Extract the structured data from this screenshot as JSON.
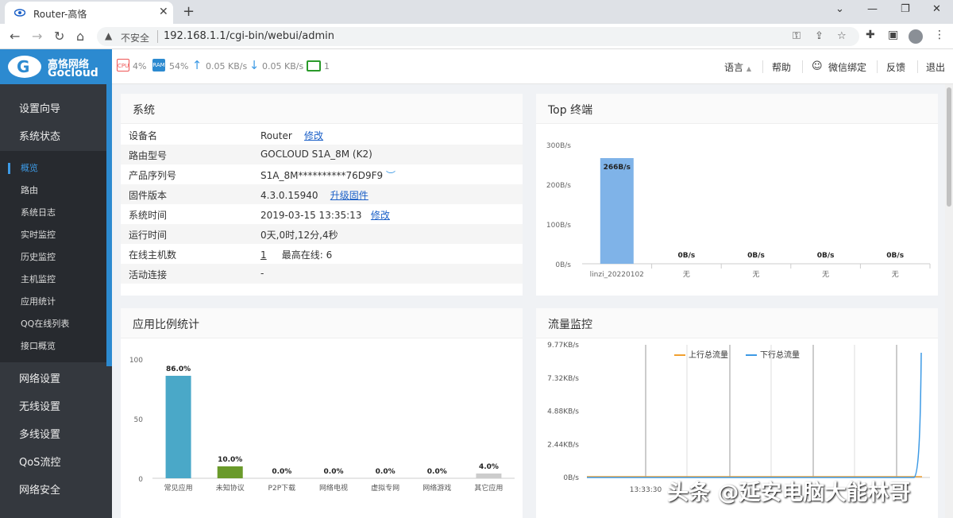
{
  "browser": {
    "tab_title": "Router-高恪",
    "insecure_label": "不安全",
    "url": "192.168.1.1/cgi-bin/webui/admin"
  },
  "logo": {
    "cn": "高恪网络",
    "en": "Gocloud"
  },
  "status_bar": {
    "cpu": "4%",
    "ram": "54%",
    "upload": "0.05 KB/s",
    "download": "0.05 KB/s",
    "online": "1"
  },
  "header_links": {
    "language": "语言",
    "help": "帮助",
    "wechat": "微信绑定",
    "feedback": "反馈",
    "logout": "退出"
  },
  "sidebar": {
    "groups_top": [
      "设置向导",
      "系统状态"
    ],
    "items": [
      "概览",
      "路由",
      "系统日志",
      "实时监控",
      "历史监控",
      "主机监控",
      "应用统计",
      "QQ在线列表",
      "接口概览"
    ],
    "groups_bottom": [
      "网络设置",
      "无线设置",
      "多线设置",
      "QoS流控",
      "网络安全"
    ]
  },
  "system": {
    "title": "系统",
    "rows": [
      {
        "k": "设备名",
        "v": "Router",
        "link": "修改"
      },
      {
        "k": "路由型号",
        "v": "GOCLOUD S1A_8M (K2)",
        "link": ""
      },
      {
        "k": "产品序列号",
        "v": "S1A_8M**********76D9F9",
        "link": ""
      },
      {
        "k": "固件版本",
        "v": "4.3.0.15940",
        "link": "升级固件"
      },
      {
        "k": "系统时间",
        "v": "2019-03-15 13:35:13",
        "link": "修改"
      },
      {
        "k": "运行时间",
        "v": "0天,0时,12分,4秒",
        "link": ""
      },
      {
        "k": "在线主机数",
        "v": "1",
        "link": ""
      },
      {
        "k": "活动连接",
        "v": "-",
        "link": ""
      }
    ],
    "peak_label": "最高在线: 6"
  },
  "top_panel_title": "Top 终端",
  "app_panel_title": "应用比例统计",
  "traffic_panel_title": "流量监控",
  "watermark": "头条 @延安电脑大能林哥",
  "chart_data": [
    {
      "type": "bar",
      "categories": [
        "linzi_20220102",
        "无",
        "无",
        "无",
        "无"
      ],
      "values": [
        266,
        0,
        0,
        0,
        0
      ],
      "data_labels": [
        "266B/s",
        "0B/s",
        "0B/s",
        "0B/s",
        "0B/s"
      ],
      "yticks": [
        "0B/s",
        "100B/s",
        "200B/s",
        "300B/s"
      ],
      "ylim": [
        0,
        300
      ],
      "color": "#7fb3e8"
    },
    {
      "type": "bar",
      "categories": [
        "常见应用",
        "未知协议",
        "P2P下载",
        "网络电视",
        "虚拟专网",
        "网络游戏",
        "其它应用"
      ],
      "values": [
        86.0,
        10.0,
        0.0,
        0.0,
        0.0,
        0.0,
        4.0
      ],
      "data_labels": [
        "86.0%",
        "10.0%",
        "0.0%",
        "0.0%",
        "0.0%",
        "0.0%",
        "4.0%"
      ],
      "colors": [
        "#4aa8c8",
        "#6a9a2a",
        "#cccccc",
        "#cccccc",
        "#cccccc",
        "#cccccc",
        "#cccccc"
      ],
      "yticks": [
        "0",
        "50",
        "100"
      ],
      "ylim": [
        0,
        100
      ]
    },
    {
      "type": "line",
      "series": [
        {
          "name": "上行总流量",
          "color": "#f0a030"
        },
        {
          "name": "下行总流量",
          "color": "#3d9ae5"
        }
      ],
      "yticks": [
        "0B/s",
        "2.44KB/s",
        "4.88KB/s",
        "7.32KB/s",
        "9.77KB/s"
      ],
      "xticks": [
        "13:33:30"
      ]
    }
  ]
}
